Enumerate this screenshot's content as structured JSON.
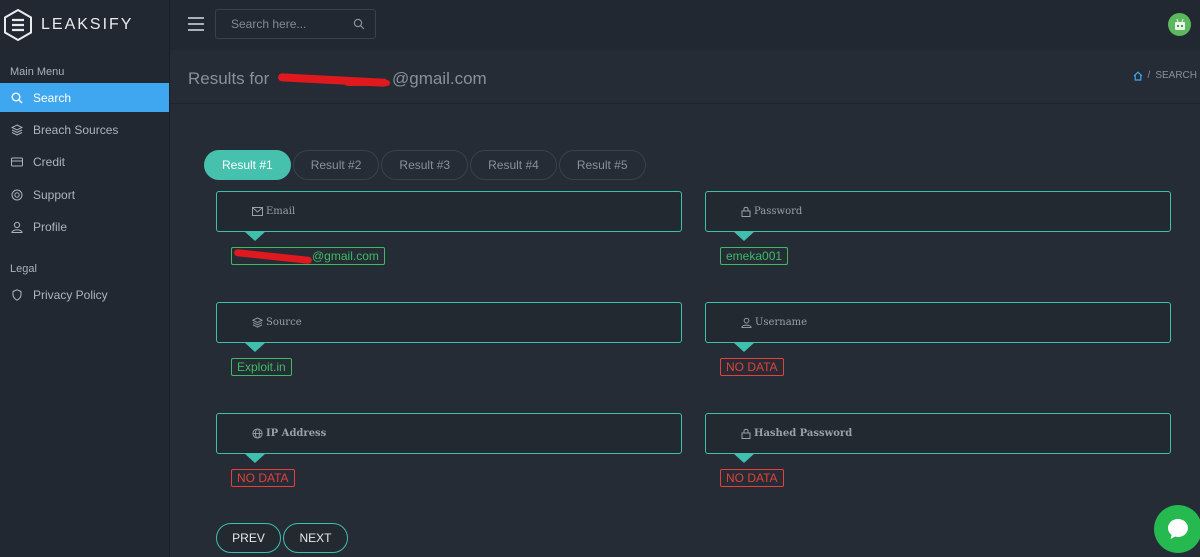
{
  "brand": {
    "name": "LEAKSIFY"
  },
  "sidebar": {
    "main_heading": "Main Menu",
    "items": [
      {
        "label": "Search",
        "icon": "search-icon"
      },
      {
        "label": "Breach Sources",
        "icon": "layers-icon"
      },
      {
        "label": "Credit",
        "icon": "credit-card-icon"
      },
      {
        "label": "Support",
        "icon": "life-buoy-icon"
      },
      {
        "label": "Profile",
        "icon": "user-icon"
      }
    ],
    "legal_heading": "Legal",
    "legal_items": [
      {
        "label": "Privacy Policy",
        "icon": "shield-icon"
      }
    ]
  },
  "topbar": {
    "search_placeholder": "Search here..."
  },
  "page": {
    "title_prefix": "Results for ",
    "title_suffix": "@gmail.com",
    "breadcrumb_sep": "/",
    "breadcrumb_current": "SEARCH"
  },
  "tabs": [
    "Result #1",
    "Result #2",
    "Result #3",
    "Result #4",
    "Result #5"
  ],
  "fields": {
    "email": {
      "label": "Email",
      "value": "@gmail.com"
    },
    "password": {
      "label": "Password",
      "value": "emeka001"
    },
    "source": {
      "label": "Source",
      "value": "Exploit.in"
    },
    "username": {
      "label": "Username",
      "value": "NO DATA"
    },
    "ip": {
      "label": "IP Address",
      "value": "NO DATA"
    },
    "hashed": {
      "label": "Hashed Password",
      "value": "NO DATA"
    }
  },
  "pager": {
    "prev": "PREV",
    "next": "NEXT"
  },
  "colors": {
    "accent": "#46c1ae",
    "active_menu": "#3fa7f0",
    "ok": "#3dbb63",
    "nodata": "#e4413b",
    "chat": "#25b94f"
  }
}
